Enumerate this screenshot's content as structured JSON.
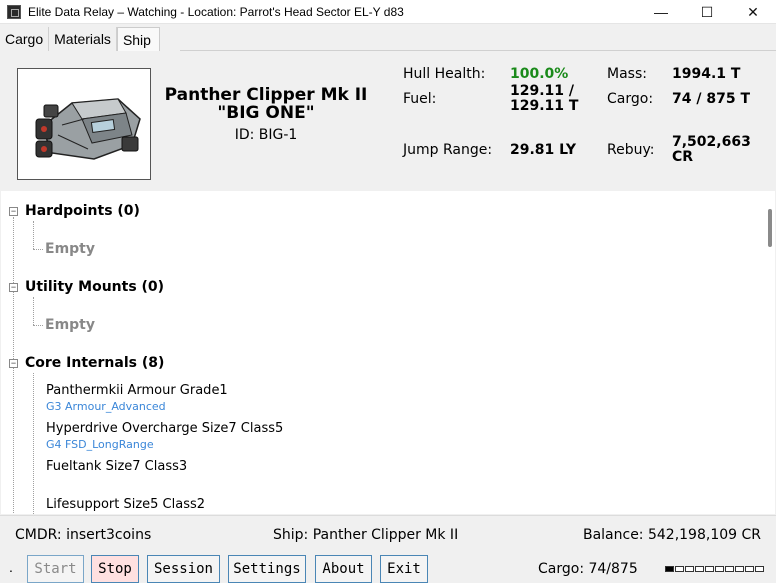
{
  "window": {
    "title": "Elite Data Relay – Watching - Location: Parrot's Head Sector EL-Y d83",
    "minimize": "—",
    "maximize": "☐",
    "close": "✕"
  },
  "tabs": [
    {
      "label": "Cargo"
    },
    {
      "label": "Materials"
    },
    {
      "label": "Ship"
    }
  ],
  "ship": {
    "name_line1": "Panther Clipper Mk II",
    "name_line2": "\"BIG ONE\"",
    "id": "ID: BIG-1",
    "stats": {
      "hull_label": "Hull Health:",
      "hull_value": "100.0%",
      "hull_color": "#1a8a1a",
      "fuel_label": "Fuel:",
      "fuel_value_1": "129.11 /",
      "fuel_value_2": "129.11 T",
      "jump_label": "Jump Range:",
      "jump_value": "29.81 LY",
      "mass_label": "Mass:",
      "mass_value": "1994.1 T",
      "cargo_label": "Cargo:",
      "cargo_value": "74 / 875 T",
      "rebuy_label": "Rebuy:",
      "rebuy_value_1": "7,502,663",
      "rebuy_value_2": "CR"
    }
  },
  "tree": {
    "hardpoints": {
      "title": "Hardpoints (0)",
      "empty": "Empty"
    },
    "utility": {
      "title": "Utility Mounts (0)",
      "empty": "Empty"
    },
    "core": {
      "title": "Core Internals (8)",
      "modules": [
        {
          "name": "Panthermkii Armour Grade1",
          "engineering": "G3 Armour_Advanced"
        },
        {
          "name": "Hyperdrive Overcharge Size7 Class5",
          "engineering": "G4 FSD_LongRange"
        },
        {
          "name": "Fueltank Size7 Class3",
          "engineering": ""
        },
        {
          "name": "Lifesupport Size5 Class2",
          "engineering": ""
        }
      ]
    }
  },
  "status": {
    "cmdr": "CMDR: insert3coins",
    "ship": "Ship: Panther Clipper Mk II",
    "balance": "Balance: 542,198,109 CR"
  },
  "toolbar": {
    "dot": ".",
    "start": "Start",
    "stop": "Stop",
    "session": "Session",
    "settings": "Settings",
    "about": "About",
    "exit": "Exit",
    "cargo": "Cargo: 74/875",
    "cargo_fraction": 0.085
  }
}
